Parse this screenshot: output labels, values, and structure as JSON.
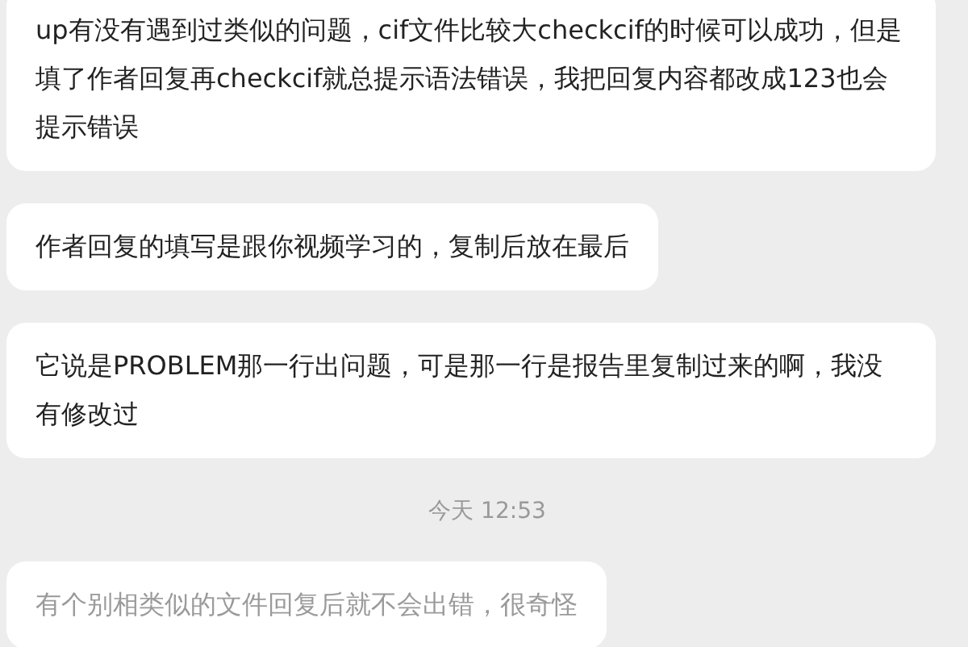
{
  "messages": [
    {
      "kind": "bubble",
      "text": "up有没有遇到过类似的问题，cif文件比较大checkcif的时候可以成功，但是填了作者回复再checkcif就总提示语法错误，我把回复内容都改成123也会提示错误",
      "dimmed": false
    },
    {
      "kind": "bubble",
      "text": "作者回复的填写是跟你视频学习的，复制后放在最后",
      "dimmed": false
    },
    {
      "kind": "bubble",
      "text": "它说是PROBLEM那一行出问题，可是那一行是报告里复制过来的啊，我没有修改过",
      "dimmed": false
    },
    {
      "kind": "time",
      "text": "今天 12:53"
    },
    {
      "kind": "bubble",
      "text": "有个别相类似的文件回复后就不会出错，很奇怪",
      "dimmed": true
    }
  ]
}
